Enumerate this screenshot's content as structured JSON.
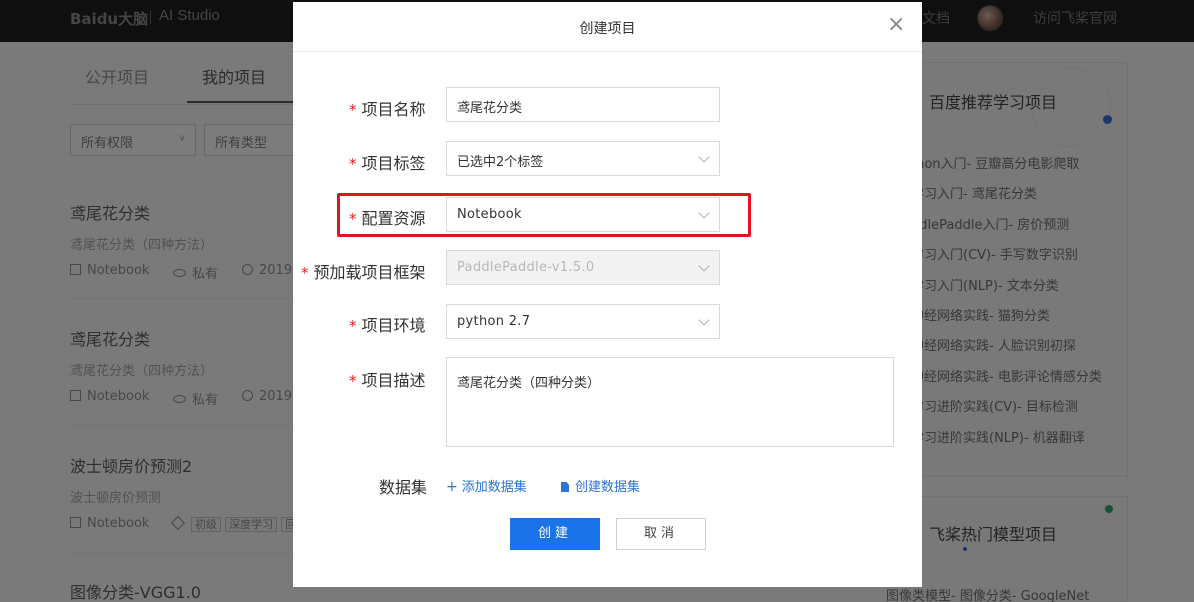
{
  "topbar": {
    "logo_text": "Baidu大脑",
    "studio": "AI Studio",
    "docs": "文档",
    "visit": "访问飞桨官网"
  },
  "tabs": {
    "public": "公开项目",
    "mine": "我的项目"
  },
  "filters": {
    "permission": "所有权限",
    "type": "所有类型"
  },
  "projects": [
    {
      "title": "鸢尾花分类",
      "subtitle": "鸢尾花分类（四种方法）",
      "env": "Notebook",
      "visibility": "私有",
      "date": "2019-"
    },
    {
      "title": "鸢尾花分类",
      "subtitle": "鸢尾花分类（四种方法）",
      "env": "Notebook",
      "visibility": "私有",
      "date": "2019-"
    },
    {
      "title": "波士顿房价预测2",
      "subtitle": "波士顿房价预测",
      "env": "Notebook",
      "tags": [
        "初级",
        "深度学习",
        "回"
      ]
    },
    {
      "title": "图像分类-VGG1.0"
    }
  ],
  "right_panel": {
    "title": "百度推荐学习项目",
    "items": [
      "thon入门- 豆瓣高分电影爬取",
      "学习入门- 鸢尾花分类",
      "ddlePaddle入门- 房价预测",
      "学习入门(CV)- 手写数字识别",
      "学习入门(NLP)- 文本分类",
      "神经网络实践- 猫狗分类",
      "神经网络实践- 人脸识别初探",
      "神经网络实践- 电影评论情感分类",
      "学习进阶实践(CV)- 目标检测",
      "学习进阶实践(NLP)- 机器翻译"
    ],
    "title2": "飞桨热门模型项目",
    "link2": "图像类模型- 图像分类- GoogleNet"
  },
  "modal": {
    "title": "创建项目",
    "close_glyph": "×",
    "required_mark": "*",
    "fields": {
      "name": {
        "label": "项目名称",
        "value": "鸢尾花分类"
      },
      "tags": {
        "label": "项目标签",
        "value": "已选中2个标签"
      },
      "resource": {
        "label": "配置资源",
        "value": "Notebook"
      },
      "framework": {
        "label": "预加载项目框架",
        "value": "PaddlePaddle-v1.5.0"
      },
      "env": {
        "label": "项目环境",
        "value": "python 2.7"
      },
      "desc": {
        "label": "项目描述",
        "value": "鸢尾花分类（四种分类）"
      }
    },
    "dataset": {
      "label": "数据集",
      "add": "添加数据集",
      "create": "创建数据集"
    },
    "buttons": {
      "ok": "创建",
      "cancel": "取消"
    }
  },
  "colors": {
    "primary": "#1a73e8",
    "link": "#2b73d7",
    "required": "#e02020",
    "highlight": "#e3141d"
  }
}
